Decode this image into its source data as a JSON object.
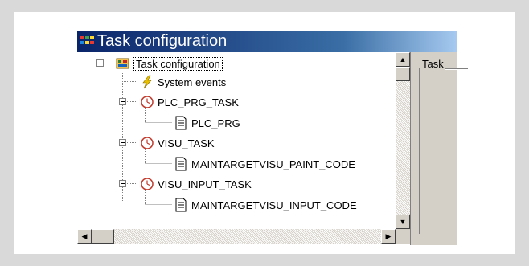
{
  "window": {
    "title": "Task configuration"
  },
  "tree": {
    "root": {
      "label": "Task configuration",
      "icon": "task-config-icon",
      "expanded": true
    },
    "items": [
      {
        "label": "System events",
        "icon": "lightning-icon",
        "level": 1
      },
      {
        "label": "PLC_PRG_TASK",
        "icon": "clock-icon",
        "level": 1,
        "expanded": true
      },
      {
        "label": "PLC_PRG",
        "icon": "document-icon",
        "level": 2
      },
      {
        "label": "VISU_TASK",
        "icon": "clock-icon",
        "level": 1,
        "expanded": true
      },
      {
        "label": "MAINTARGETVISU_PAINT_CODE",
        "icon": "document-icon",
        "level": 2
      },
      {
        "label": "VISU_INPUT_TASK",
        "icon": "clock-icon",
        "level": 1,
        "expanded": true
      },
      {
        "label": "MAINTARGETVISU_INPUT_CODE",
        "icon": "document-icon",
        "level": 2
      }
    ]
  },
  "right_panel": {
    "group_label": "Task"
  },
  "scrollbars": {
    "up_arrow": "▲",
    "down_arrow": "▼",
    "left_arrow": "◀",
    "right_arrow": "▶"
  },
  "colors": {
    "titlebar_start": "#0a246a",
    "titlebar_end": "#a6caf0",
    "clock_red": "#c0392b",
    "lightning_yellow": "#e8c000",
    "window_face": "#d4d0c8"
  }
}
